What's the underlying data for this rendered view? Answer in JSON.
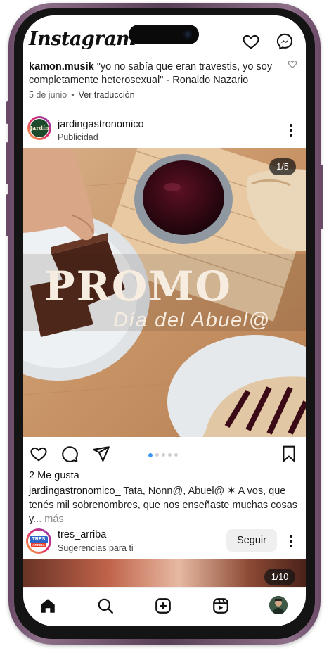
{
  "app": {
    "logo": "Instagram",
    "logo_caret": "⌄"
  },
  "previous_post": {
    "username": "kamon.musik",
    "caption": " \"yo no sabía que eran travestis, yo soy completamente heterosexual\" - Ronaldo Nazario",
    "date": "5 de junio",
    "separator": "•",
    "translate": "Ver traducción"
  },
  "sponsored_post": {
    "username": "jardingastronomico_",
    "subtitle": "Publicidad",
    "avatar_text": "Jardín",
    "carousel_counter": "1/5",
    "carousel_total_slides": 5,
    "carousel_active_slide": 1,
    "overlay_title": "PROMO",
    "overlay_subtitle": "Día del Abuel@",
    "likes": "2 Me gusta",
    "caption_user": "jardingastronomico_",
    "caption_text": " Tata, Nonn@, Abuel@ ✶ A vos, que tenés mil sobrenombres, que nos enseñaste muchas cosas y",
    "caption_more": "... más",
    "accent_color": "#3897f0"
  },
  "suggested_post": {
    "username": "tres_arriba",
    "subtitle": "Sugerencias para ti",
    "avatar_text_top": "TRES",
    "avatar_text_bottom": "ARRIBA",
    "follow_label": "Seguir",
    "carousel_counter": "1/10"
  },
  "icons": {
    "header": [
      "heart-icon",
      "messenger-icon"
    ],
    "actions": [
      "like-icon",
      "comment-icon",
      "share-icon",
      "save-icon"
    ],
    "tabs": [
      "home-icon",
      "search-icon",
      "create-icon",
      "reels-icon",
      "profile-avatar"
    ]
  }
}
